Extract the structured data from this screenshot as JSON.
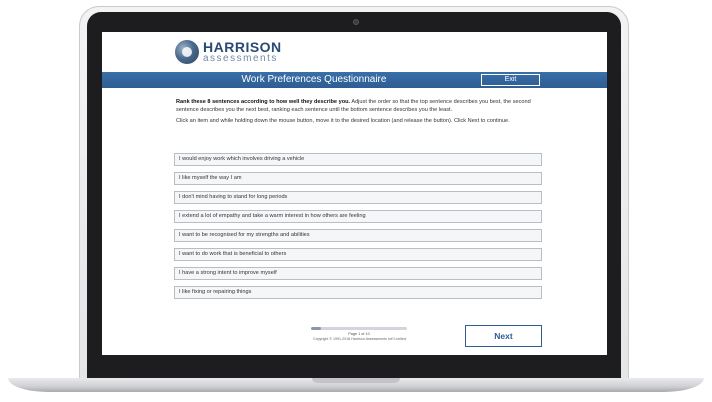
{
  "logo": {
    "name": "HARRISON",
    "subtitle": "assessments"
  },
  "header": {
    "title": "Work Preferences Questionnaire",
    "exit_label": "Exit"
  },
  "instructions": {
    "bold": "Rank these 8 sentences according to how well they describe you.",
    "rest": " Adjust the order so that the top sentence describes you best, the second sentence describes you the next best, ranking each sentence until the bottom sentence describes you the least.",
    "second": "Click an item and while holding down the mouse button, move it to the desired location (and release the button). Click Next to continue."
  },
  "items": [
    "I would enjoy work which involves driving a vehicle",
    "I like myself the way I am",
    "I don't mind having to stand for long periods",
    "I extend a lot of empathy and take a warm interest in how others are feeling",
    "I want to be recognised for my strengths and abilities",
    "I want to do work that is beneficial to others",
    "I have a strong intent to improve myself",
    "I like fixing or repairing things"
  ],
  "footer": {
    "page_text": "Page 1 of 10",
    "copyright": "Copyright © 1991-2018 Harrison Assessments Int'l Limited",
    "progress": 0.1,
    "next_label": "Next"
  },
  "colors": {
    "brand_blue": "#2d5d93",
    "logo_text": "#2a4a73"
  }
}
